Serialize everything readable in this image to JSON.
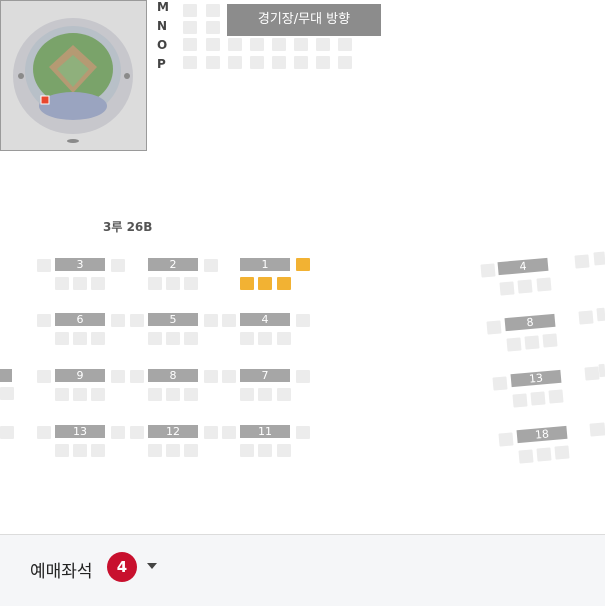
{
  "stage_direction": "경기장/무대 방향",
  "row_letters": [
    "M",
    "N",
    "O",
    "P"
  ],
  "section_title": "3루 26B",
  "rows_left": [
    "3",
    "2",
    "1",
    "6",
    "5",
    "4",
    "9",
    "8",
    "7",
    "13",
    "12",
    "11"
  ],
  "rows_right": [
    "4",
    "8",
    "13",
    "18"
  ],
  "selected_seat_count": "4",
  "bottom": {
    "label": "예매좌석",
    "count": "4"
  },
  "colors": {
    "selected": "#f2b233",
    "available": "#ececec",
    "row_tag": "#a6a6a6",
    "badge": "#c8102e"
  },
  "icons": {
    "dropdown": "chevron-down-icon"
  }
}
